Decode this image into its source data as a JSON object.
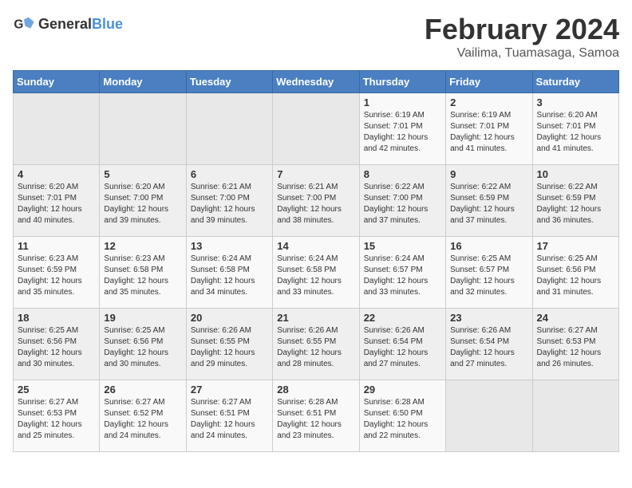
{
  "logo": {
    "general": "General",
    "blue": "Blue"
  },
  "title": {
    "month": "February 2024",
    "location": "Vailima, Tuamasaga, Samoa"
  },
  "weekdays": [
    "Sunday",
    "Monday",
    "Tuesday",
    "Wednesday",
    "Thursday",
    "Friday",
    "Saturday"
  ],
  "weeks": [
    [
      {
        "day": "",
        "info": ""
      },
      {
        "day": "",
        "info": ""
      },
      {
        "day": "",
        "info": ""
      },
      {
        "day": "",
        "info": ""
      },
      {
        "day": "1",
        "info": "Sunrise: 6:19 AM\nSunset: 7:01 PM\nDaylight: 12 hours\nand 42 minutes."
      },
      {
        "day": "2",
        "info": "Sunrise: 6:19 AM\nSunset: 7:01 PM\nDaylight: 12 hours\nand 41 minutes."
      },
      {
        "day": "3",
        "info": "Sunrise: 6:20 AM\nSunset: 7:01 PM\nDaylight: 12 hours\nand 41 minutes."
      }
    ],
    [
      {
        "day": "4",
        "info": "Sunrise: 6:20 AM\nSunset: 7:01 PM\nDaylight: 12 hours\nand 40 minutes."
      },
      {
        "day": "5",
        "info": "Sunrise: 6:20 AM\nSunset: 7:00 PM\nDaylight: 12 hours\nand 39 minutes."
      },
      {
        "day": "6",
        "info": "Sunrise: 6:21 AM\nSunset: 7:00 PM\nDaylight: 12 hours\nand 39 minutes."
      },
      {
        "day": "7",
        "info": "Sunrise: 6:21 AM\nSunset: 7:00 PM\nDaylight: 12 hours\nand 38 minutes."
      },
      {
        "day": "8",
        "info": "Sunrise: 6:22 AM\nSunset: 7:00 PM\nDaylight: 12 hours\nand 37 minutes."
      },
      {
        "day": "9",
        "info": "Sunrise: 6:22 AM\nSunset: 6:59 PM\nDaylight: 12 hours\nand 37 minutes."
      },
      {
        "day": "10",
        "info": "Sunrise: 6:22 AM\nSunset: 6:59 PM\nDaylight: 12 hours\nand 36 minutes."
      }
    ],
    [
      {
        "day": "11",
        "info": "Sunrise: 6:23 AM\nSunset: 6:59 PM\nDaylight: 12 hours\nand 35 minutes."
      },
      {
        "day": "12",
        "info": "Sunrise: 6:23 AM\nSunset: 6:58 PM\nDaylight: 12 hours\nand 35 minutes."
      },
      {
        "day": "13",
        "info": "Sunrise: 6:24 AM\nSunset: 6:58 PM\nDaylight: 12 hours\nand 34 minutes."
      },
      {
        "day": "14",
        "info": "Sunrise: 6:24 AM\nSunset: 6:58 PM\nDaylight: 12 hours\nand 33 minutes."
      },
      {
        "day": "15",
        "info": "Sunrise: 6:24 AM\nSunset: 6:57 PM\nDaylight: 12 hours\nand 33 minutes."
      },
      {
        "day": "16",
        "info": "Sunrise: 6:25 AM\nSunset: 6:57 PM\nDaylight: 12 hours\nand 32 minutes."
      },
      {
        "day": "17",
        "info": "Sunrise: 6:25 AM\nSunset: 6:56 PM\nDaylight: 12 hours\nand 31 minutes."
      }
    ],
    [
      {
        "day": "18",
        "info": "Sunrise: 6:25 AM\nSunset: 6:56 PM\nDaylight: 12 hours\nand 30 minutes."
      },
      {
        "day": "19",
        "info": "Sunrise: 6:25 AM\nSunset: 6:56 PM\nDaylight: 12 hours\nand 30 minutes."
      },
      {
        "day": "20",
        "info": "Sunrise: 6:26 AM\nSunset: 6:55 PM\nDaylight: 12 hours\nand 29 minutes."
      },
      {
        "day": "21",
        "info": "Sunrise: 6:26 AM\nSunset: 6:55 PM\nDaylight: 12 hours\nand 28 minutes."
      },
      {
        "day": "22",
        "info": "Sunrise: 6:26 AM\nSunset: 6:54 PM\nDaylight: 12 hours\nand 27 minutes."
      },
      {
        "day": "23",
        "info": "Sunrise: 6:26 AM\nSunset: 6:54 PM\nDaylight: 12 hours\nand 27 minutes."
      },
      {
        "day": "24",
        "info": "Sunrise: 6:27 AM\nSunset: 6:53 PM\nDaylight: 12 hours\nand 26 minutes."
      }
    ],
    [
      {
        "day": "25",
        "info": "Sunrise: 6:27 AM\nSunset: 6:53 PM\nDaylight: 12 hours\nand 25 minutes."
      },
      {
        "day": "26",
        "info": "Sunrise: 6:27 AM\nSunset: 6:52 PM\nDaylight: 12 hours\nand 24 minutes."
      },
      {
        "day": "27",
        "info": "Sunrise: 6:27 AM\nSunset: 6:51 PM\nDaylight: 12 hours\nand 24 minutes."
      },
      {
        "day": "28",
        "info": "Sunrise: 6:28 AM\nSunset: 6:51 PM\nDaylight: 12 hours\nand 23 minutes."
      },
      {
        "day": "29",
        "info": "Sunrise: 6:28 AM\nSunset: 6:50 PM\nDaylight: 12 hours\nand 22 minutes."
      },
      {
        "day": "",
        "info": ""
      },
      {
        "day": "",
        "info": ""
      }
    ]
  ]
}
